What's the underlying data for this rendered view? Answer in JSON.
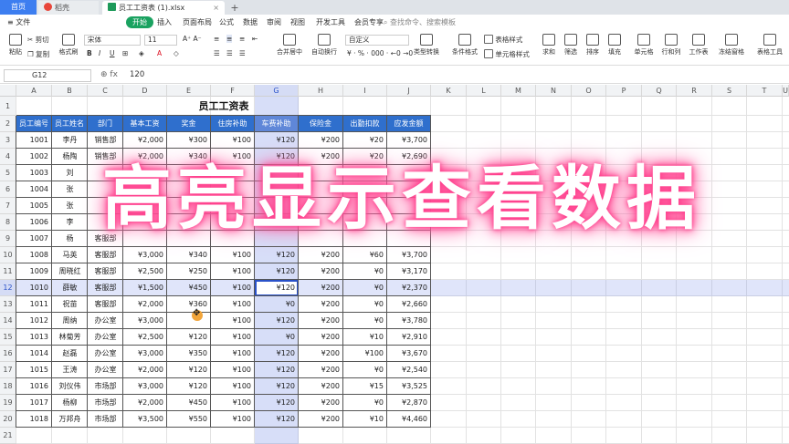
{
  "tabs": {
    "home": "首页",
    "docer": "稻壳",
    "file": "员工工资表 (1).xlsx",
    "add": "+"
  },
  "menu": {
    "file": "≡ 文件",
    "items": [
      "开始",
      "插入",
      "页面布局",
      "公式",
      "数据",
      "审阅",
      "视图",
      "开发工具",
      "会员专享"
    ],
    "search": "查找命令、搜索模板"
  },
  "toolbar": {
    "paste": "粘贴",
    "cut": "剪切",
    "copy": "复制",
    "format_painter": "格式刷",
    "font_name": "宋体",
    "font_size": "11",
    "merge": "合并居中",
    "wrap": "自动换行",
    "number_format": "自定义",
    "type_convert": "类型转换",
    "cond_format": "条件格式",
    "table_style": "表格样式",
    "cell_style": "单元格样式",
    "sum": "求和",
    "filter": "筛选",
    "sort": "排序",
    "fill": "填充",
    "cell": "单元格",
    "rowcol": "行和列",
    "sheet": "工作表",
    "freeze": "冻结窗格",
    "tools": "表格工具"
  },
  "formula_bar": {
    "cell_ref": "G12",
    "fx": "fx",
    "value": "120"
  },
  "columns": [
    "A",
    "B",
    "C",
    "D",
    "E",
    "F",
    "G",
    "H",
    "I",
    "J",
    "K",
    "L",
    "M",
    "N",
    "O",
    "P",
    "Q",
    "R",
    "S",
    "T",
    "U"
  ],
  "row_numbers": [
    "1",
    "2",
    "3",
    "4",
    "5",
    "6",
    "7",
    "8",
    "9",
    "10",
    "11",
    "12",
    "13",
    "14",
    "15",
    "16",
    "17",
    "18",
    "19",
    "20",
    "21"
  ],
  "sheet": {
    "title": "员工工资表",
    "headers": [
      "员工编号",
      "员工姓名",
      "部门",
      "基本工资",
      "奖金",
      "住房补助",
      "车费补助",
      "保险金",
      "出勤扣款",
      "应发金额"
    ],
    "rows": [
      [
        "1001",
        "李丹",
        "销售部",
        "¥2,000",
        "¥300",
        "¥100",
        "¥120",
        "¥200",
        "¥20",
        "¥3,700"
      ],
      [
        "1002",
        "杨陶",
        "销售部",
        "¥2,000",
        "¥340",
        "¥100",
        "¥120",
        "¥200",
        "¥20",
        "¥2,690"
      ],
      [
        "1003",
        "刘",
        "",
        "",
        "",
        "",
        "",
        "",
        "",
        ""
      ],
      [
        "1004",
        "张",
        "",
        "",
        "",
        "",
        "",
        "",
        "",
        ""
      ],
      [
        "1005",
        "张",
        "",
        "",
        "",
        "",
        "",
        "",
        "",
        ""
      ],
      [
        "1006",
        "李",
        "",
        "",
        "",
        "",
        "",
        "",
        "",
        ""
      ],
      [
        "1007",
        "杨",
        "客服部",
        "",
        "",
        "",
        "",
        "",
        "",
        ""
      ],
      [
        "1008",
        "马英",
        "客服部",
        "¥3,000",
        "¥340",
        "¥100",
        "¥120",
        "¥200",
        "¥60",
        "¥3,700"
      ],
      [
        "1009",
        "周晓红",
        "客服部",
        "¥2,500",
        "¥250",
        "¥100",
        "¥120",
        "¥200",
        "¥0",
        "¥3,170"
      ],
      [
        "1010",
        "薛敏",
        "客服部",
        "¥1,500",
        "¥450",
        "¥100",
        "¥120",
        "¥200",
        "¥0",
        "¥2,370"
      ],
      [
        "1011",
        "祝苗",
        "客服部",
        "¥2,000",
        "¥360",
        "¥100",
        "¥0",
        "¥200",
        "¥0",
        "¥2,660"
      ],
      [
        "1012",
        "周纳",
        "办公室",
        "¥3,000",
        "",
        "¥100",
        "¥120",
        "¥200",
        "¥0",
        "¥3,780"
      ],
      [
        "1013",
        "林菊芳",
        "办公室",
        "¥2,500",
        "¥120",
        "¥100",
        "¥0",
        "¥200",
        "¥10",
        "¥2,910"
      ],
      [
        "1014",
        "赵磊",
        "办公室",
        "¥3,000",
        "¥350",
        "¥100",
        "¥120",
        "¥200",
        "¥100",
        "¥3,670"
      ],
      [
        "1015",
        "王涛",
        "办公室",
        "¥2,000",
        "¥120",
        "¥100",
        "¥120",
        "¥200",
        "¥0",
        "¥2,540"
      ],
      [
        "1016",
        "刘仪伟",
        "市场部",
        "¥3,000",
        "¥120",
        "¥100",
        "¥120",
        "¥200",
        "¥15",
        "¥3,525"
      ],
      [
        "1017",
        "杨柳",
        "市场部",
        "¥2,000",
        "¥450",
        "¥100",
        "¥120",
        "¥200",
        "¥0",
        "¥2,870"
      ],
      [
        "1018",
        "万邦舟",
        "市场部",
        "¥3,500",
        "¥550",
        "¥100",
        "¥120",
        "¥200",
        "¥10",
        "¥4,460"
      ]
    ]
  },
  "overlay_caption": "高亮显示查看数据",
  "colors": {
    "header_bg": "#2f6fcd",
    "highlight": "#6e87e6",
    "accent": "#1aa260",
    "glow": "#ff3d8b"
  }
}
